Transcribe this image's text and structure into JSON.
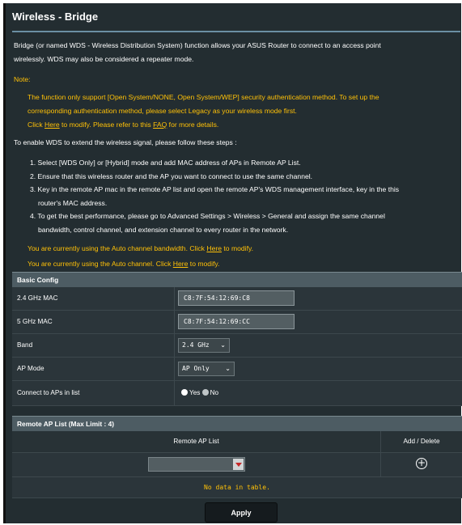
{
  "page": {
    "title": "Wireless - Bridge",
    "intro": [
      "Bridge (or named WDS - Wireless Distribution System) function allows your ASUS Router to connect to an access point",
      "wirelessly. WDS may also be considered a repeater mode."
    ],
    "note_label": "Note:",
    "note": {
      "line1": "The function only support [Open System/NONE, Open System/WEP] security authentication method. To set up the",
      "line2": "corresponding authentication method, please select Legacy as your wireless mode first.",
      "click": "Click ",
      "here": "Here",
      "after_here": " to modify. Please refer to this ",
      "faq": "FAQ",
      "after_faq": " for more details."
    },
    "steps_intro": "To enable WDS to extend the wireless signal, please follow these steps :",
    "steps": [
      {
        "main": "1. Select [WDS Only] or [Hybrid] mode and add MAC address of APs in Remote AP List.",
        "cont": ""
      },
      {
        "main": "2. Ensure that this wireless router and the AP you want to connect to use the same channel.",
        "cont": ""
      },
      {
        "main": "3. Key in the remote AP mac in the remote AP list and open the remote AP's WDS management interface, key in the this",
        "cont": "router's MAC address."
      },
      {
        "main": "4. To get the best performance, please go to Advanced Settings > Wireless > General and assign the same channel",
        "cont": "bandwidth, control channel, and extension channel to every router in the network."
      }
    ],
    "bandwidth_note": {
      "before": "You are currently using the Auto channel bandwidth. Click ",
      "link": "Here",
      "after": " to modify."
    },
    "channel_note": {
      "before": "You are currently using the Auto channel. Click ",
      "link": "Here",
      "after": " to modify."
    }
  },
  "basic_config": {
    "header": "Basic Config",
    "mac_24_label": "2.4 GHz MAC",
    "mac_24_value": "C8:7F:54:12:69:C8",
    "mac_5_label": "5 GHz MAC",
    "mac_5_value": "C8:7F:54:12:69:CC",
    "band_label": "Band",
    "band_value": "2.4 GHz",
    "ap_mode_label": "AP Mode",
    "ap_mode_value": "AP Only",
    "connect_label": "Connect to APs in list",
    "yes_label": "Yes",
    "no_label": "No",
    "connect_selected": "Yes"
  },
  "remote_ap": {
    "header": "Remote AP List (Max Limit : 4)",
    "col_list": "Remote AP List",
    "col_action": "Add / Delete",
    "empty_text": "No data in table."
  },
  "apply_label": "Apply",
  "icons": {
    "chevron": "chevron-down-icon",
    "add": "plus-circle-icon",
    "dropdown": "dropdown-arrow-icon"
  }
}
